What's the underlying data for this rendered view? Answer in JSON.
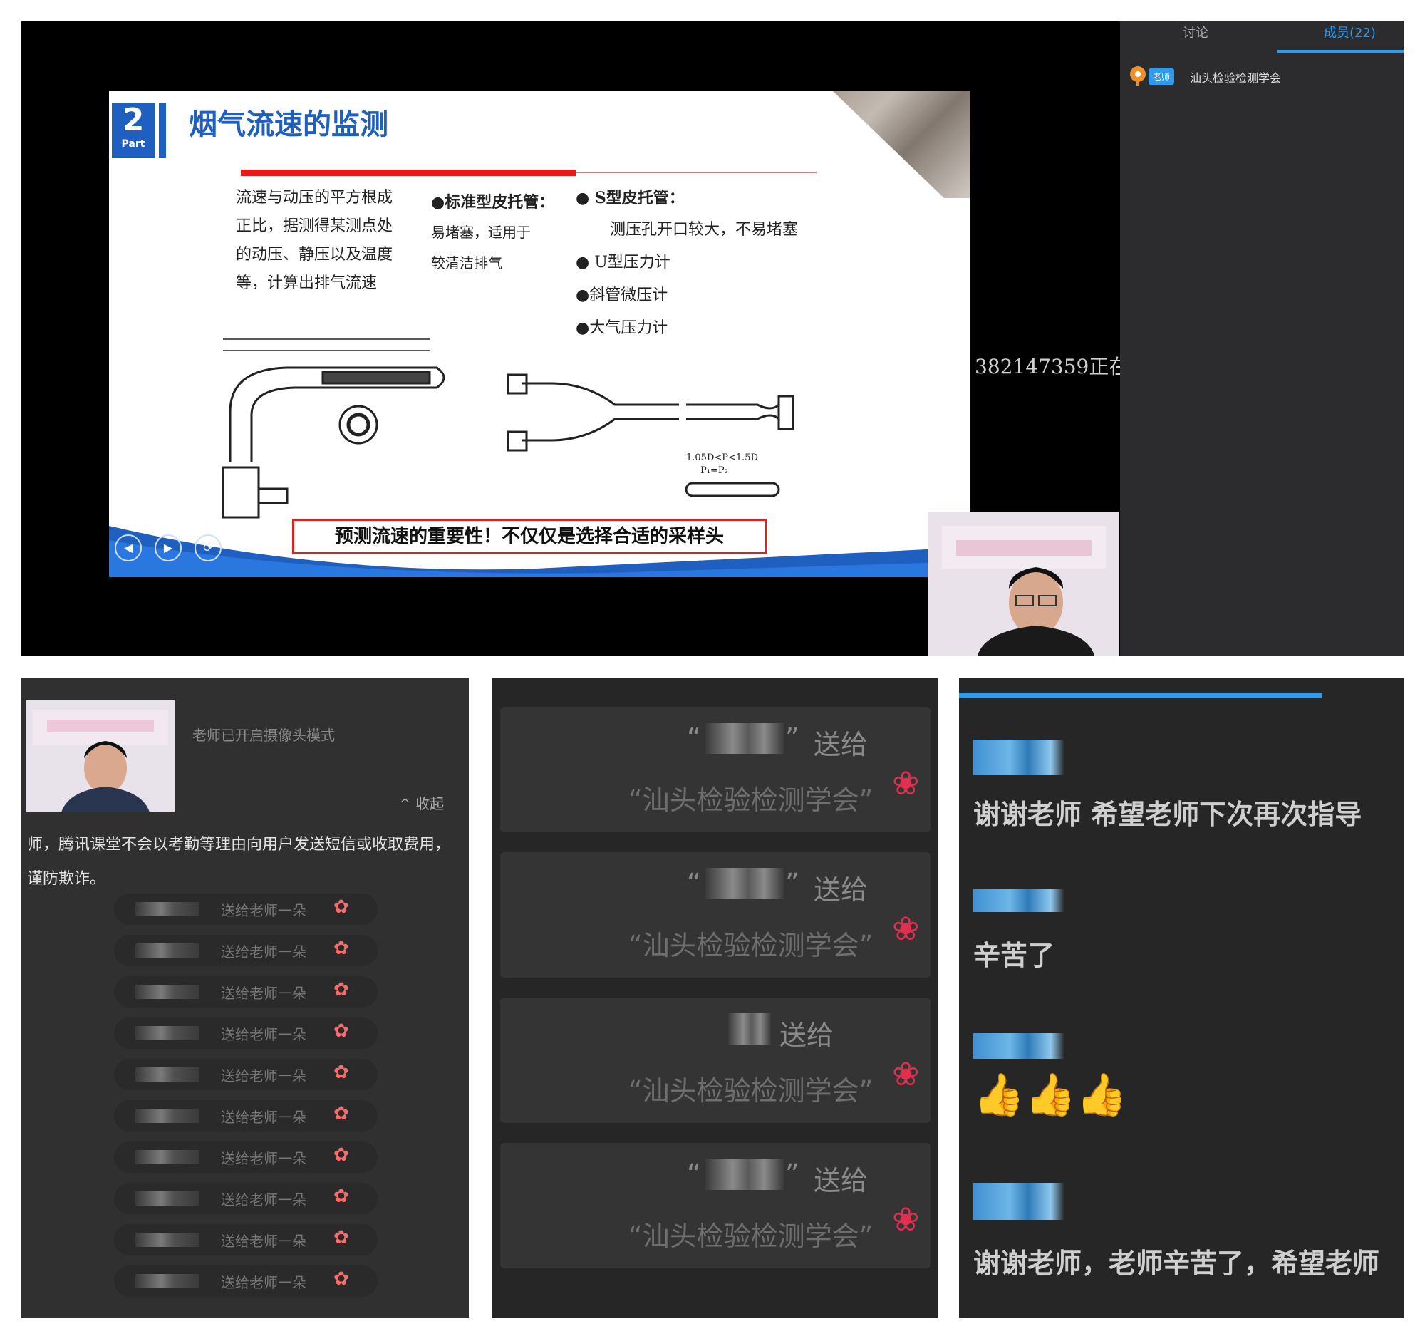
{
  "slide": {
    "part_number": "2",
    "part_label": "Part",
    "title": "烟气流速的监测",
    "description_lines": [
      "流速与动压的平方根成",
      "正比，据测得某测点处",
      "的动压、静压以及温度",
      "等，计算出排气流速"
    ],
    "standard_pitot": {
      "heading": "●标准型皮托管：",
      "lines": [
        "易堵塞，适用于",
        "较清洁排气"
      ]
    },
    "s_pitot": {
      "heading": "● S型皮托管：",
      "desc": "测压孔开口较大，不易堵塞"
    },
    "instruments": [
      "● U型压力计",
      "●斜管微压计",
      "●大气压力计"
    ],
    "caution": "预测流速的重要性！不仅仅是选择合适的采样头",
    "nav_buttons": [
      "◀",
      "▶",
      "⟳"
    ],
    "diagram_labels": {
      "formula": "1.05D<P<1.5D",
      "eq": "P₁=P₂"
    }
  },
  "scroll_text": "382147359正在",
  "sidebar": {
    "tabs": [
      "讨论",
      "成员(22)"
    ],
    "active_tab": 1,
    "member": {
      "badge": "老师",
      "name": "汕头检验检测学会"
    }
  },
  "panel1": {
    "notice": "老师已开启摄像头模式",
    "collapse": "^ 收起",
    "tip": "师，腾讯课堂不会以考勤等理由向用户发送短信或收取费用，谨防欺诈。",
    "gift_rows": [
      {
        "msg": "送给老师一朵"
      },
      {
        "msg": "送给老师一朵"
      },
      {
        "msg": "送给老师一朵"
      },
      {
        "msg": "送给老师一朵"
      },
      {
        "msg": "送给老师一朵"
      },
      {
        "msg": "送给老师一朵"
      },
      {
        "msg": "送给老师一朵"
      },
      {
        "msg": "送给老师一朵"
      },
      {
        "msg": "送给老师一朵"
      },
      {
        "msg": "送给老师一朵"
      }
    ]
  },
  "panel2": {
    "cards": [
      {
        "quote_open": "“",
        "quote_close": "”",
        "send": "送给",
        "recipient": "“汕头检验检测学会”"
      },
      {
        "quote_open": "“",
        "quote_close": "”",
        "send": "送给",
        "recipient": "“汕头检验检测学会”"
      },
      {
        "quote_open": "",
        "quote_close": "",
        "send": "送给",
        "recipient": "“汕头检验检测学会”"
      },
      {
        "quote_open": "“",
        "quote_close": "”",
        "send": "送给",
        "recipient": "“汕头检验检测学会”"
      }
    ]
  },
  "panel3": {
    "messages": [
      {
        "text": "谢谢老师 希望老师下次再次指导"
      },
      {
        "text": "辛苦了"
      },
      {
        "text": "👍👍👍"
      },
      {
        "text": "谢谢老师，老师辛苦了，希望老师"
      }
    ]
  },
  "colors": {
    "accent": "#2d9cf0",
    "slide_blue": "#1f5fbf",
    "caution_red": "#e02020"
  }
}
